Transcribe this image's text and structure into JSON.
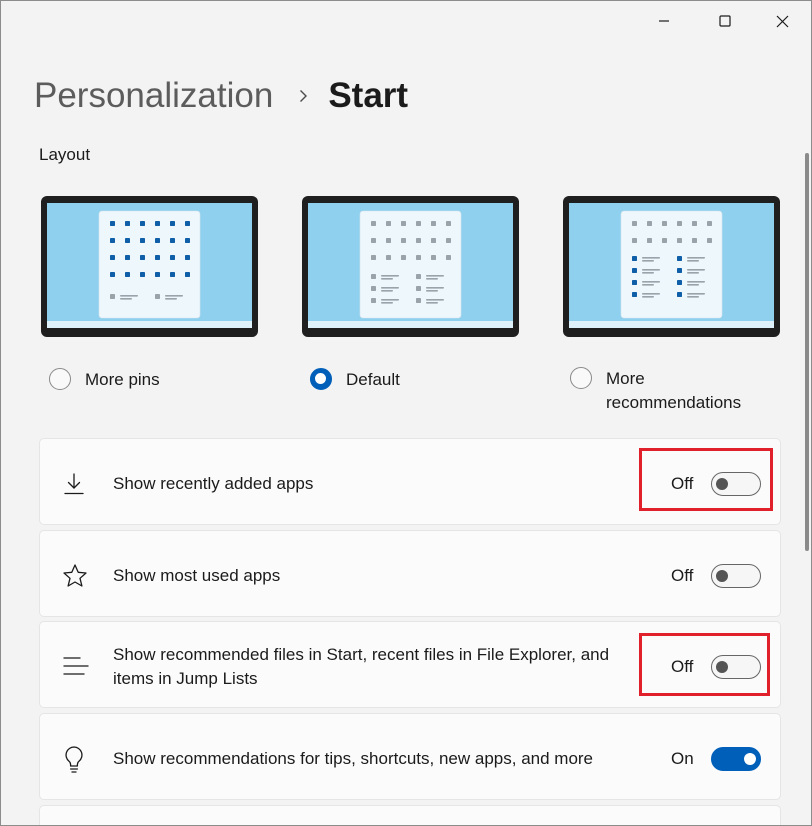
{
  "window": {
    "controls": {
      "minimize": "minimize-icon",
      "maximize": "maximize-icon",
      "close": "close-icon"
    }
  },
  "breadcrumb": {
    "parent": "Personalization",
    "current": "Start"
  },
  "layout_section": {
    "label": "Layout",
    "options": [
      {
        "id": "more-pins",
        "label": "More pins",
        "selected": false
      },
      {
        "id": "default",
        "label": "Default",
        "selected": true
      },
      {
        "id": "more-recs",
        "label": "More recommendations",
        "selected": false
      }
    ]
  },
  "settings": [
    {
      "label": "Show recently added apps",
      "state": "Off",
      "icon": "download-icon"
    },
    {
      "label": "Show most used apps",
      "state": "Off",
      "icon": "star-icon"
    },
    {
      "label": "Show recommended files in Start, recent files in File Explorer, and items in Jump Lists",
      "state": "Off",
      "icon": "list-lines-icon"
    },
    {
      "label": "Show recommendations for tips, shortcuts, new apps, and more",
      "state": "On",
      "icon": "lightbulb-icon"
    }
  ],
  "colors": {
    "accent": "#005fb8",
    "highlight_box": "#e0202a",
    "preview_wallpaper": "#8fd0ee",
    "preview_panel": "#eef7fc"
  }
}
